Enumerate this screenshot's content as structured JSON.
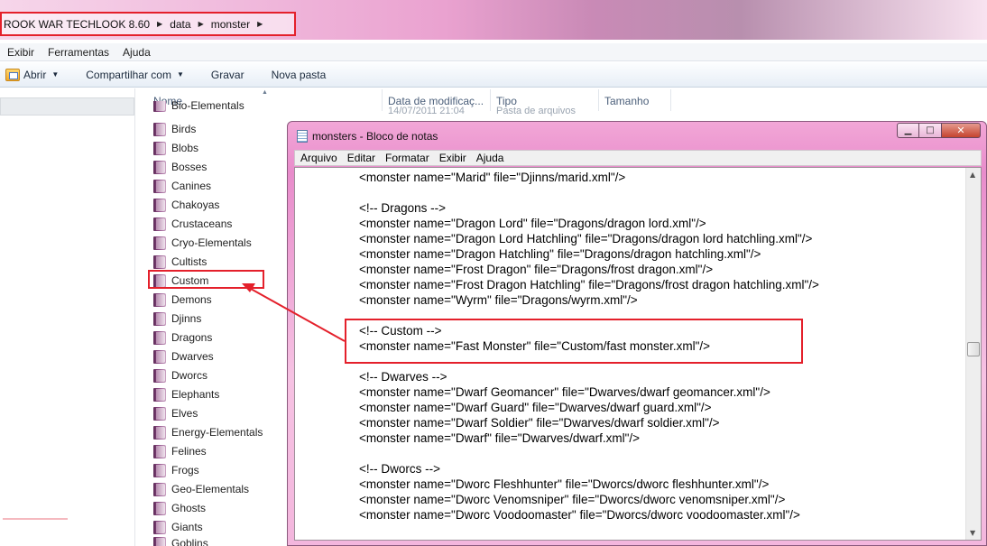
{
  "explorer": {
    "breadcrumb": {
      "items": [
        "ROOK WAR TECHLOOK 8.60",
        "data",
        "monster"
      ]
    },
    "menu": [
      "Exibir",
      "Ferramentas",
      "Ajuda"
    ],
    "toolbar": {
      "open_label": "Abrir",
      "share_label": "Compartilhar com",
      "burn_label": "Gravar",
      "new_folder_label": "Nova pasta"
    },
    "columns": {
      "name": "Nome",
      "modified": "Data de modificaç...",
      "type": "Tipo",
      "size": "Tamanho"
    },
    "first_row": {
      "name": "Bio-Elementals",
      "modified": "14/07/2011 21:04",
      "type": "Pasta de arquivos"
    },
    "folders": [
      "Birds",
      "Blobs",
      "Bosses",
      "Canines",
      "Chakoyas",
      "Crustaceans",
      "Cryo-Elementals",
      "Cultists",
      "Custom",
      "Demons",
      "Djinns",
      "Dragons",
      "Dwarves",
      "Dworcs",
      "Elephants",
      "Elves",
      "Energy-Elementals",
      "Felines",
      "Frogs",
      "Geo-Elementals",
      "Ghosts",
      "Giants",
      "Goblins"
    ],
    "highlighted_folder": "Custom"
  },
  "notepad": {
    "title": "monsters - Bloco de notas",
    "menu": [
      "Arquivo",
      "Editar",
      "Formatar",
      "Exibir",
      "Ajuda"
    ],
    "lines": [
      "<monster name=\"Marid\" file=\"Djinns/marid.xml\"/>",
      "",
      "<!-- Dragons -->",
      "<monster name=\"Dragon Lord\" file=\"Dragons/dragon lord.xml\"/>",
      "<monster name=\"Dragon Lord Hatchling\" file=\"Dragons/dragon lord hatchling.xml\"/>",
      "<monster name=\"Dragon Hatchling\" file=\"Dragons/dragon hatchling.xml\"/>",
      "<monster name=\"Frost Dragon\" file=\"Dragons/frost dragon.xml\"/>",
      "<monster name=\"Frost Dragon Hatchling\" file=\"Dragons/frost dragon hatchling.xml\"/>",
      "<monster name=\"Wyrm\" file=\"Dragons/wyrm.xml\"/>",
      "",
      "<!-- Custom -->",
      "<monster name=\"Fast Monster\" file=\"Custom/fast monster.xml\"/>",
      "",
      "<!-- Dwarves -->",
      "<monster name=\"Dwarf Geomancer\" file=\"Dwarves/dwarf geomancer.xml\"/>",
      "<monster name=\"Dwarf Guard\" file=\"Dwarves/dwarf guard.xml\"/>",
      "<monster name=\"Dwarf Soldier\" file=\"Dwarves/dwarf soldier.xml\"/>",
      "<monster name=\"Dwarf\" file=\"Dwarves/dwarf.xml\"/>",
      "",
      "<!-- Dworcs -->",
      "<monster name=\"Dworc Fleshhunter\" file=\"Dworcs/dworc fleshhunter.xml\"/>",
      "<monster name=\"Dworc Venomsniper\" file=\"Dworcs/dworc venomsniper.xml\"/>",
      "<monster name=\"Dworc Voodoomaster\" file=\"Dworcs/dworc voodoomaster.xml\"/>"
    ],
    "highlighted_block": [
      "<!-- Custom -->",
      "<monster name=\"Fast Monster\" file=\"Custom/fast monster.xml\"/>"
    ]
  },
  "colors": {
    "annotation_red": "#e4202b",
    "title_pink": "#f2a7d7"
  }
}
